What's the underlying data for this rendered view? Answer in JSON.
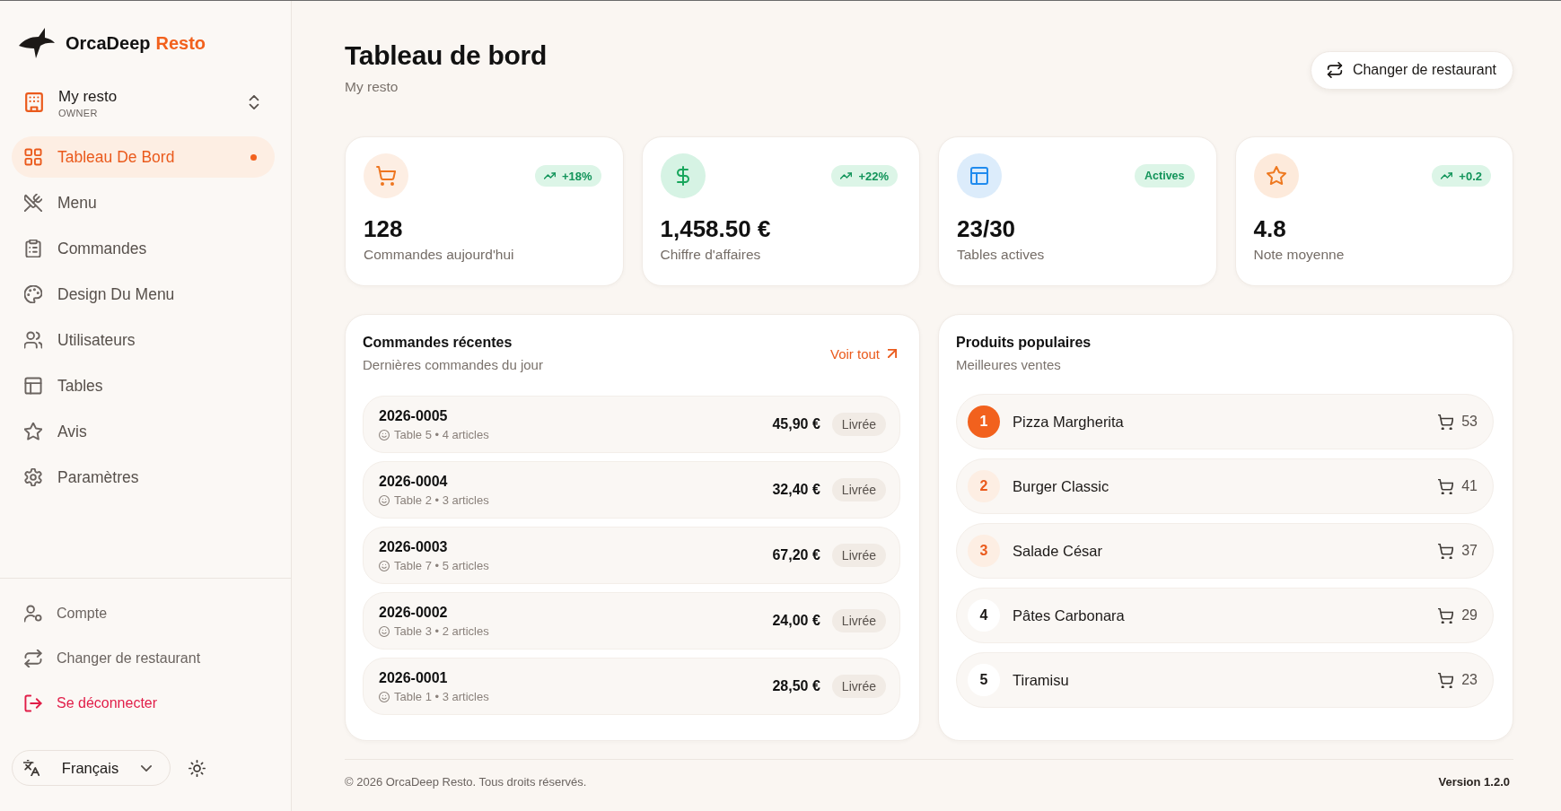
{
  "sidebar": {
    "brand": {
      "name": "OrcaDeep",
      "accent": "Resto"
    },
    "restaurant": {
      "name": "My resto",
      "role": "OWNER"
    },
    "nav": [
      {
        "label": "Tableau De Bord",
        "selected": true
      },
      {
        "label": "Menu",
        "selected": false
      },
      {
        "label": "Commandes",
        "selected": false
      },
      {
        "label": "Design Du Menu",
        "selected": false
      },
      {
        "label": "Utilisateurs",
        "selected": false
      },
      {
        "label": "Tables",
        "selected": false
      },
      {
        "label": "Avis",
        "selected": false
      },
      {
        "label": "Paramètres",
        "selected": false
      }
    ],
    "bottom_links": [
      {
        "label": "Compte",
        "kind": "normal"
      },
      {
        "label": "Changer de restaurant",
        "kind": "normal"
      },
      {
        "label": "Se déconnecter",
        "kind": "danger"
      }
    ],
    "language": "Français"
  },
  "header": {
    "title": "Tableau de bord",
    "subtitle": "My resto",
    "button": "Changer de restaurant"
  },
  "stats": [
    {
      "value": "128",
      "label": "Commandes aujourd'hui",
      "color": "#fdeee3",
      "badge": {
        "text": "+18%",
        "kind": "trend"
      }
    },
    {
      "value": "1,458.50 €",
      "label": "Chiffre d'affaires",
      "color": "#d6f3e4",
      "badge": {
        "text": "+22%",
        "kind": "trend"
      }
    },
    {
      "value": "23/30",
      "label": "Tables actives",
      "color": "#dcecfb",
      "badge": {
        "text": "Actives",
        "kind": "status"
      }
    },
    {
      "value": "4.8",
      "label": "Note moyenne",
      "color": "#fdeadb",
      "badge": {
        "text": "+0.2",
        "kind": "trend"
      }
    }
  ],
  "recent_orders": {
    "title": "Commandes récentes",
    "subtitle": "Dernières commandes du jour",
    "link": "Voir tout",
    "rows": [
      {
        "id": "2026-0005",
        "details": "Table 5 • 4 articles",
        "amount": "45,90 €",
        "status": "Livrée"
      },
      {
        "id": "2026-0004",
        "details": "Table 2 • 3 articles",
        "amount": "32,40 €",
        "status": "Livrée"
      },
      {
        "id": "2026-0003",
        "details": "Table 7 • 5 articles",
        "amount": "67,20 €",
        "status": "Livrée"
      },
      {
        "id": "2026-0002",
        "details": "Table 3 • 2 articles",
        "amount": "24,00 €",
        "status": "Livrée"
      },
      {
        "id": "2026-0001",
        "details": "Table 1 • 3 articles",
        "amount": "28,50 €",
        "status": "Livrée"
      }
    ]
  },
  "popular_products": {
    "title": "Produits populaires",
    "subtitle": "Meilleures ventes",
    "rows": [
      {
        "rank": "1",
        "name": "Pizza Margherita",
        "count": "53",
        "kind": "first"
      },
      {
        "rank": "2",
        "name": "Burger Classic",
        "count": "41",
        "kind": "podium"
      },
      {
        "rank": "3",
        "name": "Salade César",
        "count": "37",
        "kind": "podium"
      },
      {
        "rank": "4",
        "name": "Pâtes Carbonara",
        "count": "29",
        "kind": "plain"
      },
      {
        "rank": "5",
        "name": "Tiramisu",
        "count": "23",
        "kind": "plain"
      }
    ]
  },
  "footer": {
    "copyright": "© 2026 OrcaDeep Resto. Tous droits réservés.",
    "version": "Version 1.2.0"
  }
}
